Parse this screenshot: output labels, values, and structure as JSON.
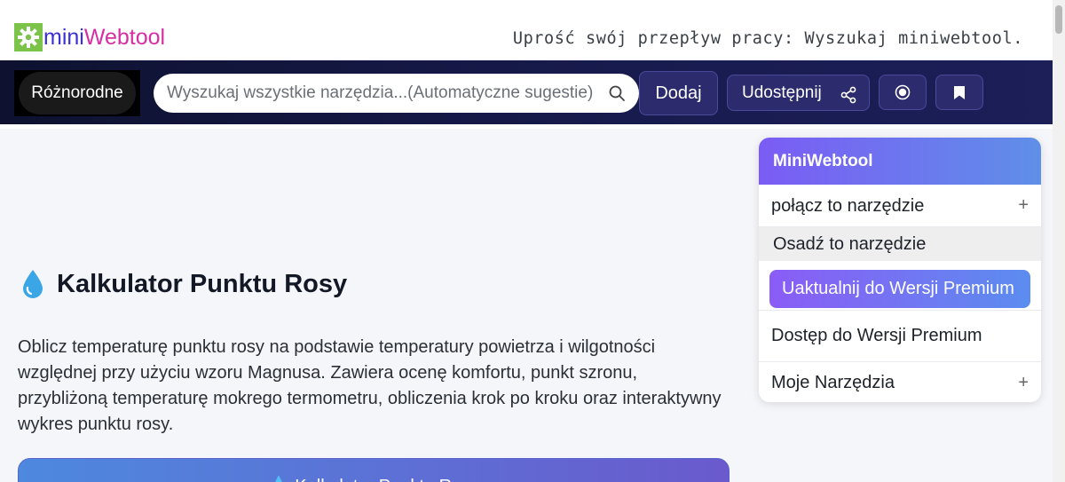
{
  "brand": {
    "logo_mini": "mini",
    "logo_web": "Webtool",
    "tagline": "Uprość swój przepływ pracy: Wyszukaj miniwebtool."
  },
  "nav": {
    "category_label": "Różnorodne",
    "search_placeholder": "Wyszukaj wszystkie narzędzia...(Automatyczne sugestie)",
    "add_label": "Dodaj",
    "share_label": "Udostępnij",
    "icons": [
      "gear-icon",
      "search-icon",
      "share-icon",
      "record-icon",
      "bookmark-icon"
    ]
  },
  "main": {
    "title": "Kalkulator Punktu Rosy",
    "title_icon": "droplet-icon",
    "description": "Oblicz temperaturę punktu rosy na podstawie temperatury powietrza i wilgotności względnej przy użyciu wzoru Magnusa. Zawiera ocenę komfortu, punkt szronu, przybliżoną temperaturę mokrego termometru, obliczenia krok po kroku oraz interaktywny wykres punktu rosy.",
    "card_title": "💧 Kalkulator Punktu Rosy"
  },
  "sidebar": {
    "header": "MiniWebtool",
    "link_tool": "połącz to narzędzie",
    "embed_tool": "Osadź to narzędzie",
    "upgrade": "Uaktualnij do Wersji Premium",
    "premium_access": "Dostęp do Wersji Premium",
    "my_tools": "Moje Narzędzia",
    "plus": "+"
  },
  "colors": {
    "navbar": "#151845",
    "accent_purple": "#7b5cf5",
    "accent_blue": "#5f8fe8",
    "logo_green": "#7cc34a"
  }
}
